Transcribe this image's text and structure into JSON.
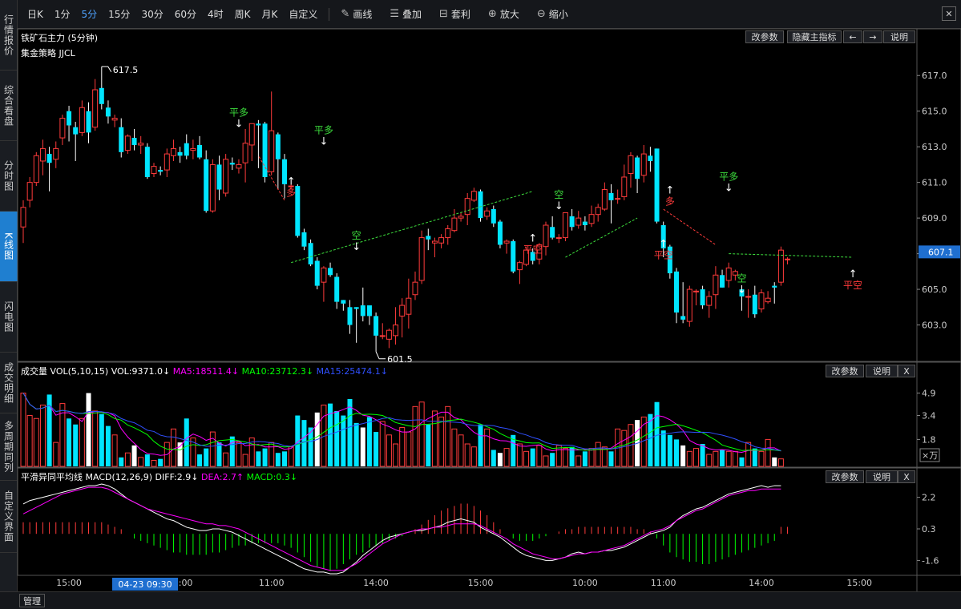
{
  "sidebar": {
    "tabs": [
      {
        "label": "行情报价",
        "top": 0,
        "h": 88
      },
      {
        "label": "综合看盘",
        "top": 88,
        "h": 88
      },
      {
        "label": "分时图",
        "top": 176,
        "h": 88
      },
      {
        "label": "K线图",
        "top": 264,
        "h": 88,
        "active": true
      },
      {
        "label": "闪电图",
        "top": 352,
        "h": 88
      },
      {
        "label": "成交明细",
        "top": 440,
        "h": 76
      },
      {
        "label": "多周期同列",
        "top": 516,
        "h": 84
      },
      {
        "label": "自定义界面",
        "top": 600,
        "h": 90
      }
    ]
  },
  "toolbar": {
    "periods": [
      "日K",
      "1分",
      "5分",
      "15分",
      "30分",
      "60分",
      "4时",
      "周K",
      "月K",
      "自定义"
    ],
    "active_period": "5分",
    "tools": [
      {
        "icon": "✎",
        "name": "draw",
        "label": "画线"
      },
      {
        "icon": "☰",
        "name": "overlay",
        "label": "叠加"
      },
      {
        "icon": "⊟",
        "name": "arbitrage",
        "label": "套利"
      },
      {
        "icon": "⊕",
        "name": "zoom-in",
        "label": "放大"
      },
      {
        "icon": "⊖",
        "name": "zoom-out",
        "label": "缩小"
      }
    ],
    "close": "✕"
  },
  "main_panel": {
    "title": "铁矿石主力 (5分钟)",
    "strategy": "集金策略 JJCL",
    "buttons": [
      "改参数",
      "隐藏主指标",
      "←",
      "→",
      "说明"
    ],
    "price_ticks": [
      "617.0",
      "615.0",
      "613.0",
      "611.0",
      "609.0",
      "607.0",
      "605.0",
      "603.0"
    ],
    "current_price": "607.1",
    "high_label": "617.5",
    "low_label": "601.5"
  },
  "signals": [
    {
      "text": "平多",
      "type": "close-long"
    },
    {
      "text": "多",
      "type": "long"
    },
    {
      "text": "平多",
      "type": "close-long"
    },
    {
      "text": "空",
      "type": "short"
    },
    {
      "text": "平空",
      "type": "close-short"
    },
    {
      "text": "空",
      "type": "short"
    },
    {
      "text": "多",
      "type": "long"
    },
    {
      "text": "平空",
      "type": "close-short"
    },
    {
      "text": "平多",
      "type": "close-long"
    },
    {
      "text": "空",
      "type": "short"
    },
    {
      "text": "平空",
      "type": "close-short"
    }
  ],
  "volume_panel": {
    "name": "成交量",
    "params": "VOL(5,10,15)",
    "vol": "VOL:9371.0↓",
    "ma5": "MA5:18511.4↓",
    "ma10": "MA10:23712.3↓",
    "ma15": "MA15:25474.1↓",
    "ticks": [
      "4.9",
      "3.4",
      "1.8"
    ],
    "unit": "×万",
    "buttons": [
      "改参数",
      "说明",
      "X"
    ]
  },
  "macd_panel": {
    "name": "平滑异同平均线",
    "params": "MACD(12,26,9)",
    "diff": "DIFF:2.9↓",
    "dea": "DEA:2.7↑",
    "macd": "MACD:0.3↓",
    "ticks": [
      "2.2",
      "0.3",
      "-1.6"
    ],
    "buttons": [
      "改参数",
      "说明",
      "X"
    ]
  },
  "time_axis": {
    "labels": [
      "15:00",
      "10:00",
      "11:00",
      "14:00",
      "15:00",
      "10:00",
      "11:00",
      "14:00",
      "15:00"
    ],
    "cursor": "04-23 09:30"
  },
  "bottom": {
    "manage": "管理"
  },
  "colors": {
    "up": "#ff3b3b",
    "down": "#00e5ff",
    "ma5": "#ff00ff",
    "ma10": "#00ff00",
    "ma15": "#3050ff",
    "signal_green": "#3cdc3c",
    "signal_red": "#ff3b3b",
    "axis_text": "#cccccc"
  },
  "chart_data": {
    "type": "candlestick",
    "y_range": [
      601.0,
      618.0
    ],
    "candles": [
      [
        608.5,
        609.6,
        607.6,
        610.0
      ],
      [
        610.0,
        611.0,
        609.6,
        611.3
      ],
      [
        611.0,
        612.5,
        610.8,
        612.7
      ],
      [
        612.2,
        612.9,
        611.4,
        613.4
      ],
      [
        612.6,
        612.1,
        610.5,
        613.0
      ],
      [
        612.3,
        612.9,
        611.8,
        613.3
      ],
      [
        613.5,
        614.6,
        613.1,
        614.8
      ],
      [
        615.0,
        614.2,
        613.3,
        615.3
      ],
      [
        614.1,
        613.7,
        612.2,
        614.4
      ],
      [
        613.8,
        615.2,
        613.6,
        615.6
      ],
      [
        615.0,
        613.8,
        613.2,
        615.5
      ],
      [
        614.1,
        616.2,
        613.9,
        616.8
      ],
      [
        616.3,
        615.4,
        615.1,
        617.5
      ],
      [
        615.2,
        614.7,
        614.3,
        615.6
      ],
      [
        614.5,
        614.6,
        614.1,
        614.8
      ],
      [
        614.1,
        612.7,
        612.4,
        614.6
      ],
      [
        612.8,
        613.6,
        612.6,
        613.7
      ],
      [
        613.5,
        613.1,
        612.8,
        614.0
      ],
      [
        613.1,
        613.2,
        612.6,
        613.6
      ],
      [
        613.0,
        611.3,
        611.2,
        613.2
      ],
      [
        611.5,
        611.9,
        611.3,
        612.1
      ],
      [
        611.7,
        611.6,
        611.4,
        611.9
      ],
      [
        611.7,
        612.6,
        611.3,
        612.9
      ],
      [
        612.5,
        612.9,
        612.2,
        613.4
      ],
      [
        612.7,
        612.5,
        612.1,
        613.0
      ],
      [
        613.2,
        612.5,
        612.3,
        613.7
      ],
      [
        612.8,
        612.9,
        612.3,
        613.4
      ],
      [
        613.1,
        612.4,
        612.3,
        613.6
      ],
      [
        612.3,
        609.4,
        609.3,
        612.8
      ],
      [
        609.4,
        612.0,
        609.3,
        612.3
      ],
      [
        612.0,
        610.6,
        610.0,
        612.5
      ],
      [
        610.4,
        612.3,
        610.2,
        612.6
      ],
      [
        612.1,
        612.0,
        611.7,
        612.4
      ],
      [
        611.8,
        612.0,
        611.5,
        612.3
      ],
      [
        612.1,
        613.2,
        611.0,
        614.0
      ],
      [
        613.1,
        614.3,
        612.2,
        614.3
      ],
      [
        614.3,
        614.2,
        611.8,
        614.5
      ],
      [
        614.3,
        611.3,
        611.0,
        614.4
      ],
      [
        611.6,
        613.9,
        611.4,
        616.1
      ],
      [
        613.7,
        612.3,
        610.6,
        613.8
      ],
      [
        612.3,
        610.9,
        610.1,
        612.6
      ],
      [
        610.8,
        610.8,
        610.6,
        610.9
      ],
      [
        610.8,
        608.0,
        607.9,
        610.9
      ],
      [
        608.2,
        607.4,
        607.2,
        608.4
      ],
      [
        607.6,
        606.4,
        606.3,
        607.8
      ],
      [
        606.6,
        605.2,
        605.0,
        606.8
      ],
      [
        605.4,
        606.2,
        604.3,
        606.3
      ],
      [
        606.2,
        605.8,
        605.7,
        606.5
      ],
      [
        605.7,
        604.3,
        603.9,
        605.9
      ],
      [
        604.4,
        604.2,
        603.8,
        604.4
      ],
      [
        604.0,
        603.0,
        602.5,
        604.4
      ],
      [
        604.0,
        603.9,
        602.0,
        604.0
      ],
      [
        604.1,
        603.5,
        603.2,
        605.1
      ],
      [
        604.1,
        603.5,
        603.0,
        604.0
      ],
      [
        603.5,
        602.4,
        601.5,
        603.7
      ],
      [
        602.4,
        602.4,
        602.2,
        603.1
      ],
      [
        602.2,
        602.7,
        601.7,
        602.8
      ],
      [
        602.4,
        603.0,
        601.9,
        604.0
      ],
      [
        603.5,
        604.1,
        602.3,
        604.5
      ],
      [
        603.6,
        604.5,
        602.8,
        605.6
      ],
      [
        604.7,
        605.4,
        604.4,
        606.0
      ],
      [
        605.5,
        607.9,
        605.3,
        608.3
      ],
      [
        608.0,
        607.8,
        607.2,
        608.4
      ],
      [
        607.6,
        607.7,
        606.8,
        607.9
      ],
      [
        607.6,
        607.9,
        607.3,
        608.1
      ],
      [
        607.9,
        608.4,
        607.5,
        608.6
      ],
      [
        608.3,
        609.0,
        608.2,
        609.5
      ],
      [
        609.0,
        609.1,
        608.8,
        609.3
      ],
      [
        609.2,
        610.1,
        608.6,
        610.4
      ],
      [
        610.0,
        610.5,
        609.9,
        610.7
      ],
      [
        610.5,
        609.0,
        608.8,
        610.6
      ],
      [
        609.1,
        609.4,
        608.9,
        609.6
      ],
      [
        609.5,
        608.7,
        608.5,
        609.7
      ],
      [
        608.8,
        607.5,
        607.3,
        608.9
      ],
      [
        607.6,
        607.7,
        607.0,
        607.8
      ],
      [
        607.7,
        606.0,
        605.9,
        607.8
      ],
      [
        606.1,
        606.5,
        605.3,
        606.6
      ],
      [
        606.4,
        607.2,
        606.3,
        607.4
      ],
      [
        607.1,
        606.6,
        606.4,
        607.3
      ],
      [
        606.7,
        607.5,
        606.4,
        607.6
      ],
      [
        607.4,
        608.6,
        606.9,
        608.8
      ],
      [
        608.5,
        607.9,
        607.8,
        609.1
      ],
      [
        607.9,
        607.9,
        607.6,
        608.1
      ],
      [
        607.9,
        609.3,
        607.7,
        609.3
      ],
      [
        609.1,
        608.5,
        608.3,
        609.5
      ],
      [
        608.6,
        609.0,
        608.4,
        609.4
      ],
      [
        608.8,
        608.6,
        608.3,
        609.1
      ],
      [
        608.7,
        609.2,
        608.5,
        609.7
      ],
      [
        609.2,
        609.6,
        608.8,
        609.8
      ],
      [
        609.5,
        610.6,
        609.4,
        611.0
      ],
      [
        610.4,
        610.0,
        608.7,
        610.9
      ],
      [
        610.1,
        610.1,
        609.8,
        610.6
      ],
      [
        610.2,
        611.3,
        610.0,
        612.0
      ],
      [
        611.5,
        612.5,
        610.7,
        612.7
      ],
      [
        612.4,
        611.2,
        610.4,
        612.5
      ],
      [
        611.4,
        612.6,
        611.0,
        613.1
      ],
      [
        612.5,
        612.2,
        611.6,
        613.0
      ],
      [
        612.9,
        608.8,
        608.7,
        612.9
      ],
      [
        608.6,
        607.3,
        606.8,
        608.8
      ],
      [
        607.4,
        605.9,
        605.6,
        607.5
      ],
      [
        606.0,
        603.7,
        603.1,
        606.2
      ],
      [
        603.5,
        603.3,
        603.1,
        605.4
      ],
      [
        603.2,
        605.0,
        602.9,
        605.2
      ],
      [
        604.9,
        604.9,
        604.1,
        605.0
      ],
      [
        605.0,
        604.1,
        603.9,
        605.2
      ],
      [
        604.1,
        604.6,
        603.4,
        604.9
      ],
      [
        604.7,
        605.8,
        603.9,
        606.3
      ],
      [
        605.8,
        605.1,
        605.1,
        606.1
      ],
      [
        605.5,
        606.2,
        605.1,
        606.5
      ],
      [
        605.8,
        606.0,
        605.5,
        606.1
      ],
      [
        605.0,
        604.6,
        603.8,
        605.1
      ],
      [
        604.6,
        604.6,
        603.4,
        605.0
      ],
      [
        604.7,
        603.6,
        603.4,
        605.2
      ],
      [
        603.9,
        604.8,
        603.7,
        605.0
      ],
      [
        604.3,
        604.5,
        604.2,
        604.9
      ],
      [
        605.2,
        605.1,
        604.2,
        605.4
      ],
      [
        605.4,
        607.2,
        605.2,
        607.4
      ],
      [
        606.7,
        606.7,
        606.4,
        606.8
      ]
    ],
    "volume_scale": [
      0,
      6
    ],
    "volumes": [
      4.9,
      3.4,
      3.2,
      4.1,
      4.8,
      1.6,
      4.2,
      3.2,
      2.8,
      3.2,
      4.9,
      3.7,
      3.5,
      2.7,
      2.1,
      0.6,
      0.9,
      1.4,
      0.6,
      0.8,
      0.4,
      0.5,
      1.6,
      2.5,
      1.6,
      3.2,
      1.9,
      0.8,
      1.2,
      2.3,
      1.6,
      0.9,
      2.0,
      1.6,
      0.8,
      1.9,
      1.0,
      1.2,
      1.6,
      0.9,
      1.0,
      1.3,
      3.4,
      3.1,
      2.6,
      3.6,
      4.1,
      4.2,
      3.7,
      3.4,
      4.5,
      2.9,
      2.6,
      3.3,
      2.3,
      3.0,
      2.1,
      1.5,
      2.6,
      2.3,
      4.0,
      4.3,
      2.8,
      3.7,
      3.3,
      4.0,
      2.5,
      2.1,
      1.5,
      1.3,
      2.8,
      2.5,
      1.1,
      0.9,
      1.2,
      2.1,
      1.5,
      1.0,
      1.2,
      1.4,
      0.7,
      0.9,
      1.4,
      1.2,
      1.3,
      0.7,
      1.0,
      1.2,
      1.6,
      1.3,
      1.0,
      2.5,
      2.4,
      2.8,
      3.1,
      3.3,
      3.5,
      4.3,
      2.4,
      2.1,
      1.8,
      1.4,
      1.0,
      1.2,
      1.5,
      0.8,
      1.0,
      1.1,
      1.0,
      1.0,
      0.6,
      1.6,
      1.2,
      1.0,
      1.8,
      0.6,
      0.5
    ],
    "macd_range": [
      -2.4,
      3.0
    ],
    "diff": [
      1.8,
      2.0,
      2.1,
      2.2,
      2.3,
      2.4,
      2.5,
      2.6,
      2.7,
      2.8,
      2.9,
      2.9,
      3.0,
      2.9,
      2.7,
      2.4,
      2.1,
      1.9,
      1.7,
      1.5,
      1.3,
      1.1,
      0.9,
      0.8,
      0.6,
      0.4,
      0.3,
      0.2,
      0.2,
      0.3,
      0.3,
      0.2,
      0.1,
      -0.1,
      -0.3,
      -0.5,
      -0.7,
      -0.9,
      -1.1,
      -1.3,
      -1.5,
      -1.7,
      -1.9,
      -2.1,
      -2.2,
      -2.3,
      -2.3,
      -2.4,
      -2.4,
      -2.3,
      -2.0,
      -1.7,
      -1.3,
      -1.0,
      -0.7,
      -0.4,
      -0.2,
      -0.1,
      0.0,
      0.1,
      0.2,
      0.2,
      0.3,
      0.4,
      0.5,
      0.7,
      0.8,
      0.9,
      0.8,
      0.7,
      0.4,
      0.2,
      0.0,
      -0.2,
      -0.5,
      -0.8,
      -1.1,
      -1.3,
      -1.4,
      -1.5,
      -1.6,
      -1.6,
      -1.5,
      -1.4,
      -1.2,
      -1.1,
      -1.2,
      -1.1,
      -1.1,
      -1.0,
      -1.0,
      -0.9,
      -0.8,
      -0.6,
      -0.4,
      -0.2,
      0.0,
      0.1,
      0.2,
      0.4,
      0.8,
      1.1,
      1.3,
      1.5,
      1.6,
      1.8,
      2.0,
      2.2,
      2.4,
      2.5,
      2.6,
      2.7,
      2.8,
      2.9,
      2.8,
      2.9,
      2.9
    ],
    "dea": [
      1.2,
      1.4,
      1.6,
      1.8,
      2.0,
      2.2,
      2.4,
      2.5,
      2.6,
      2.7,
      2.8,
      2.8,
      2.8,
      2.7,
      2.5,
      2.3,
      2.1,
      1.9,
      1.7,
      1.5,
      1.4,
      1.3,
      1.2,
      1.1,
      1.0,
      0.9,
      0.8,
      0.7,
      0.6,
      0.6,
      0.5,
      0.5,
      0.4,
      0.3,
      0.1,
      -0.1,
      -0.3,
      -0.5,
      -0.7,
      -0.9,
      -1.1,
      -1.3,
      -1.5,
      -1.7,
      -1.9,
      -2.0,
      -2.1,
      -2.2,
      -2.2,
      -2.2,
      -2.0,
      -1.8,
      -1.5,
      -1.2,
      -0.9,
      -0.6,
      -0.4,
      -0.2,
      0.0,
      0.1,
      0.2,
      0.3,
      0.3,
      0.4,
      0.4,
      0.5,
      0.6,
      0.6,
      0.6,
      0.6,
      0.5,
      0.3,
      0.1,
      -0.1,
      -0.3,
      -0.6,
      -0.8,
      -1.0,
      -1.2,
      -1.3,
      -1.4,
      -1.5,
      -1.5,
      -1.4,
      -1.3,
      -1.2,
      -1.2,
      -1.1,
      -1.1,
      -1.0,
      -0.9,
      -0.8,
      -0.7,
      -0.5,
      -0.3,
      -0.1,
      0.1,
      0.2,
      0.3,
      0.5,
      0.8,
      1.0,
      1.2,
      1.4,
      1.5,
      1.7,
      1.9,
      2.1,
      2.3,
      2.4,
      2.5,
      2.6,
      2.6,
      2.7,
      2.7,
      2.7,
      2.7
    ],
    "macd_hist": [
      0.5,
      0.5,
      0.5,
      0.5,
      0.5,
      0.5,
      0.5,
      0.5,
      0.5,
      0.5,
      0.5,
      0.5,
      0.5,
      0.4,
      0.3,
      0.2,
      0.0,
      -0.2,
      -0.3,
      -0.4,
      -0.5,
      -0.6,
      -0.7,
      -0.8,
      -0.8,
      -0.9,
      -0.9,
      -0.9,
      -0.9,
      -0.8,
      -0.8,
      -0.7,
      -0.6,
      -0.5,
      -0.5,
      -0.4,
      -0.4,
      -0.4,
      -0.4,
      -0.4,
      -0.5,
      -0.6,
      -0.8,
      -1.0,
      -1.2,
      -1.4,
      -1.5,
      -1.6,
      -1.5,
      -1.3,
      -1.1,
      -0.9,
      -0.8,
      -0.6,
      -0.5,
      -0.4,
      -0.3,
      -0.2,
      -0.1,
      0.0,
      0.2,
      0.4,
      0.6,
      0.8,
      1.0,
      1.1,
      1.2,
      1.3,
      1.3,
      1.2,
      1.0,
      0.8,
      0.5,
      0.2,
      0.0,
      -0.2,
      -0.3,
      -0.3,
      -0.3,
      -0.2,
      -0.1,
      0.0,
      0.1,
      0.2,
      0.2,
      0.3,
      0.3,
      0.3,
      0.3,
      0.3,
      0.3,
      0.3,
      0.3,
      0.3,
      0.2,
      0.2,
      0.1,
      -0.2,
      -0.5,
      -0.8,
      -1.0,
      -1.1,
      -1.2,
      -1.2,
      -1.3,
      -1.3,
      -1.2,
      -1.1,
      -1.0,
      -0.9,
      -0.8,
      -0.7,
      -0.6,
      -0.5,
      -0.4,
      -0.3,
      0.3,
      0.3
    ]
  }
}
